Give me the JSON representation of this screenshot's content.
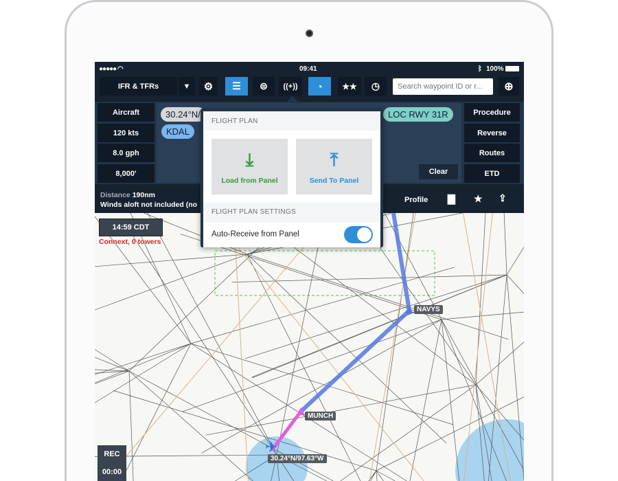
{
  "status_bar": {
    "time": "09:41",
    "battery": "100%"
  },
  "toolbar": {
    "layer_selector": "IFR & TFRs",
    "search_placeholder": "Search waypoint ID or r..."
  },
  "flight_plan": {
    "left_buttons": [
      "Aircraft",
      "120 kts",
      "8.0 gph",
      "8,000'"
    ],
    "right_buttons": [
      "Procedure",
      "Reverse",
      "Routes",
      "ETD"
    ],
    "route_chips": [
      "30.24°N/",
      "KDAL",
      "LOC RWY 31R"
    ],
    "clear_label": "Clear",
    "distance_label": "Distance",
    "distance_value": "190nm",
    "winds_note": "Winds aloft not included (no",
    "profile_label": "Profile"
  },
  "popover": {
    "section1": "FLIGHT PLAN",
    "load_label": "Load from Panel",
    "send_label": "Send To Panel",
    "section2": "FLIGHT PLAN SETTINGS",
    "auto_receive_label": "Auto-Receive from Panel",
    "auto_receive_on": true
  },
  "map": {
    "clock": "14:59 CDT",
    "connext_status": "Connext, 0 towers",
    "rec_label": "REC",
    "rec_time": "00:00",
    "waypoints": [
      "NAVYS",
      "MUNCH"
    ],
    "position_label": "30.24°N/97.63°W"
  },
  "colors": {
    "accent": "#2e8fd8",
    "load_green": "#3a9a3a",
    "send_blue": "#2e8fd8",
    "route": "#5577e0",
    "active_leg": "#e060e0",
    "alert_red": "#e02020"
  }
}
